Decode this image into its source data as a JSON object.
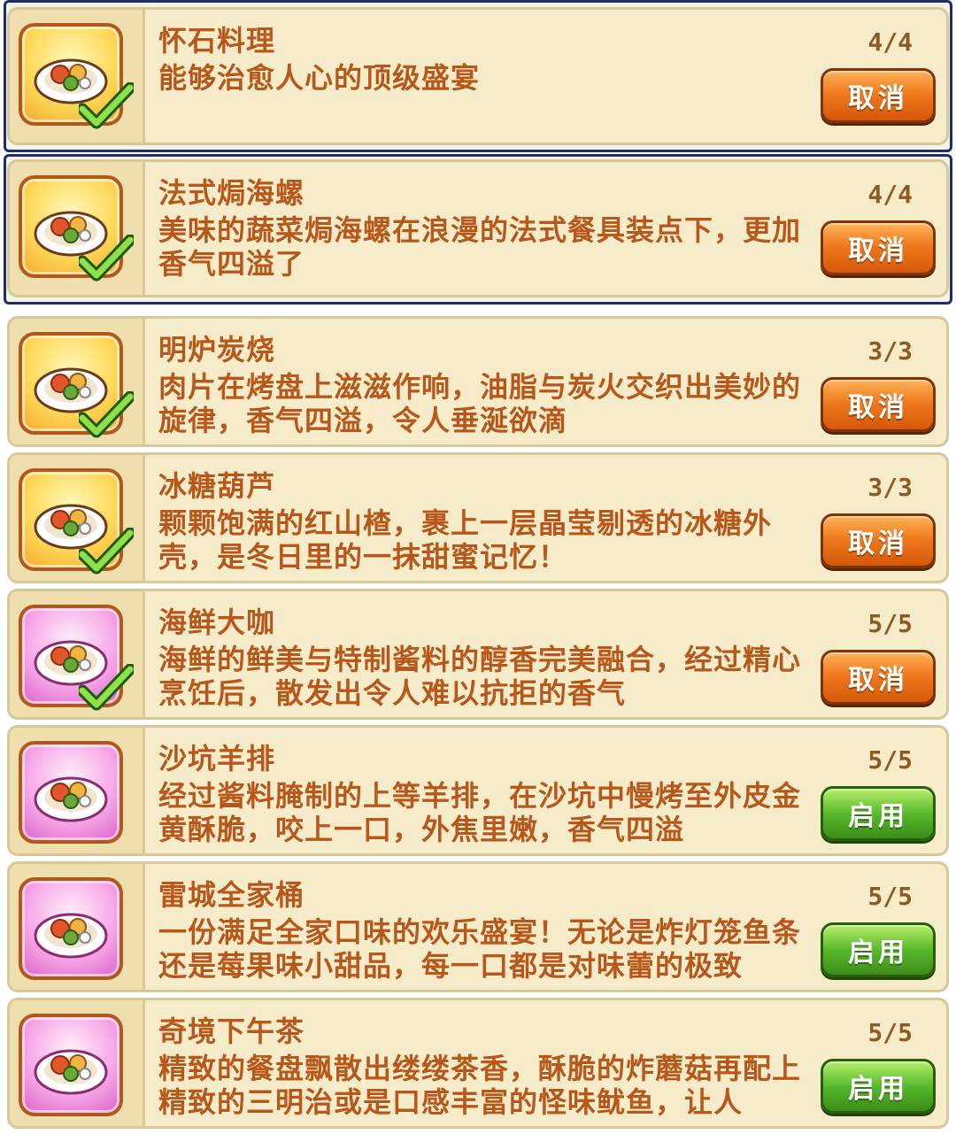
{
  "recipes": [
    {
      "title": "怀石料理",
      "desc": "能够治愈人心的顶级盛宴",
      "count": "4/4",
      "button": "取消",
      "button_type": "cancel",
      "icon": "kaiseki-dish-icon",
      "bg": "gold",
      "completed": true
    },
    {
      "title": "法式焗海螺",
      "desc": "美味的蔬菜焗海螺在浪漫的法式餐具装点下，更加香气四溢了",
      "count": "4/4",
      "button": "取消",
      "button_type": "cancel",
      "icon": "baked-snail-dish-icon",
      "bg": "gold",
      "completed": true
    },
    {
      "title": "明炉炭烧",
      "desc": "肉片在烤盘上滋滋作响，油脂与炭火交织出美妙的旋律，香气四溢，令人垂涎欲滴",
      "count": "3/3",
      "button": "取消",
      "button_type": "cancel",
      "icon": "charcoal-grill-icon",
      "bg": "gold",
      "completed": true
    },
    {
      "title": "冰糖葫芦",
      "desc": "颗颗饱满的红山楂，裹上一层晶莹剔透的冰糖外壳，是冬日里的一抹甜蜜记忆！",
      "count": "3/3",
      "button": "取消",
      "button_type": "cancel",
      "icon": "candied-haws-icon",
      "bg": "gold",
      "completed": true
    },
    {
      "title": "海鲜大咖",
      "desc": "海鲜的鲜美与特制酱料的醇香完美融合，经过精心烹饪后，散发出令人难以抗拒的香气",
      "count": "5/5",
      "button": "取消",
      "button_type": "cancel",
      "icon": "seafood-platter-icon",
      "bg": "pink",
      "completed": true
    },
    {
      "title": "沙坑羊排",
      "desc": "经过酱料腌制的上等羊排，在沙坑中慢烤至外皮金黄酥脆，咬上一口，外焦里嫩，香气四溢",
      "count": "5/5",
      "button": "启用",
      "button_type": "enable",
      "icon": "lamb-chop-icon",
      "bg": "pink",
      "completed": false
    },
    {
      "title": "雷城全家桶",
      "desc": "一份满足全家口味的欢乐盛宴！无论是炸灯笼鱼条还是莓果味小甜品，每一口都是对味蕾的极致",
      "count": "5/5",
      "button": "启用",
      "button_type": "enable",
      "icon": "family-bucket-icon",
      "bg": "pink",
      "completed": false
    },
    {
      "title": "奇境下午茶",
      "desc": "精致的餐盘飘散出缕缕茶香，酥脆的炸蘑菇再配上精致的三明治或是口感丰富的怪味鱿鱼，让人",
      "count": "5/5",
      "button": "启用",
      "button_type": "enable",
      "icon": "afternoon-tea-icon",
      "bg": "pink",
      "completed": false
    }
  ],
  "colors": {
    "text": "#b9561a",
    "cancel": "#f07a1e",
    "enable": "#58b92c",
    "frame": "#1c2f6b"
  }
}
